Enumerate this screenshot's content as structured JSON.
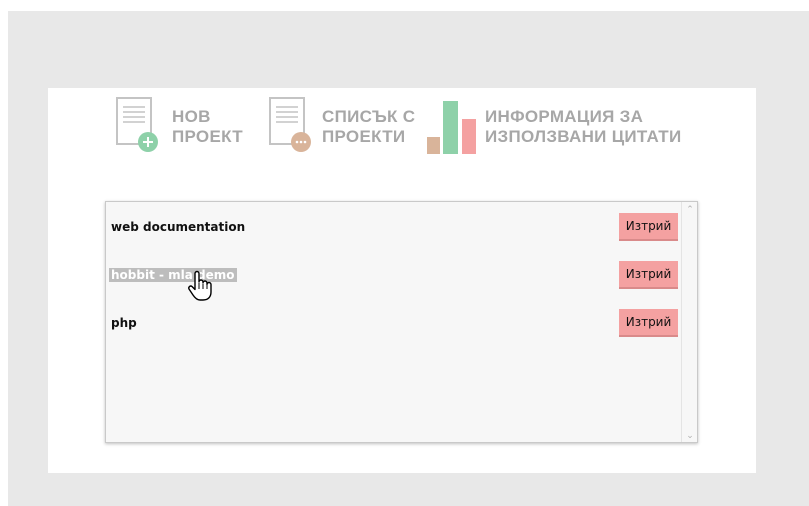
{
  "nav": {
    "new_project": {
      "line1": "НОВ",
      "line2": "ПРОЕКТ"
    },
    "project_list": {
      "line1": "СПИСЪК С",
      "line2": "ПРОЕКТИ"
    },
    "citations_info": {
      "line1": "ИНФОРМАЦИЯ ЗА",
      "line2": "ИЗПОЛЗВАНИ ЦИТАТИ"
    }
  },
  "projects": [
    {
      "name": "web documentation",
      "delete_label": "Изтрий",
      "selected": false
    },
    {
      "name": "hobbit - mla demo",
      "delete_label": "Изтрий",
      "selected": true
    },
    {
      "name": "php",
      "delete_label": "Изтрий",
      "selected": false
    }
  ],
  "icons": {
    "new_project": "document-plus-icon",
    "project_list": "document-list-icon",
    "citations_info": "bar-chart-icon",
    "cursor": "hand-pointer-icon"
  },
  "colors": {
    "green_accent": "#8ed1a9",
    "tan_accent": "#d9b49a",
    "red_accent": "#f4a1a1",
    "nav_text": "#a7a7a7"
  }
}
